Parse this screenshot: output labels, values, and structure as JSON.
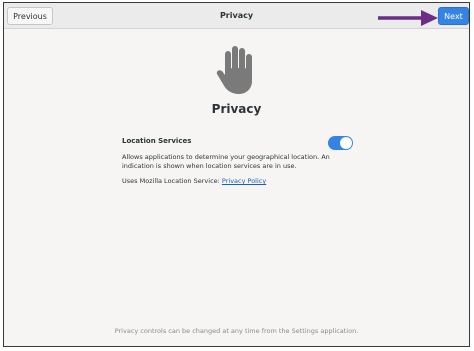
{
  "header": {
    "title": "Privacy",
    "previous_label": "Previous",
    "next_label": "Next"
  },
  "main": {
    "heading": "Privacy",
    "location": {
      "label": "Location Services",
      "enabled": true,
      "description": "Allows applications to determine your geographical location. An indication is shown when location services are in use.",
      "uses_prefix": "Uses Mozilla Location Service: ",
      "link_text": "Privacy Policy"
    }
  },
  "footer": {
    "text": "Privacy controls can be changed at any time from the Settings application."
  },
  "colors": {
    "accent": "#3584e4",
    "annotation_arrow": "#6b2d86"
  },
  "icons": {
    "hand": "hand-stop-icon",
    "arrow": "annotation-arrow-icon"
  }
}
